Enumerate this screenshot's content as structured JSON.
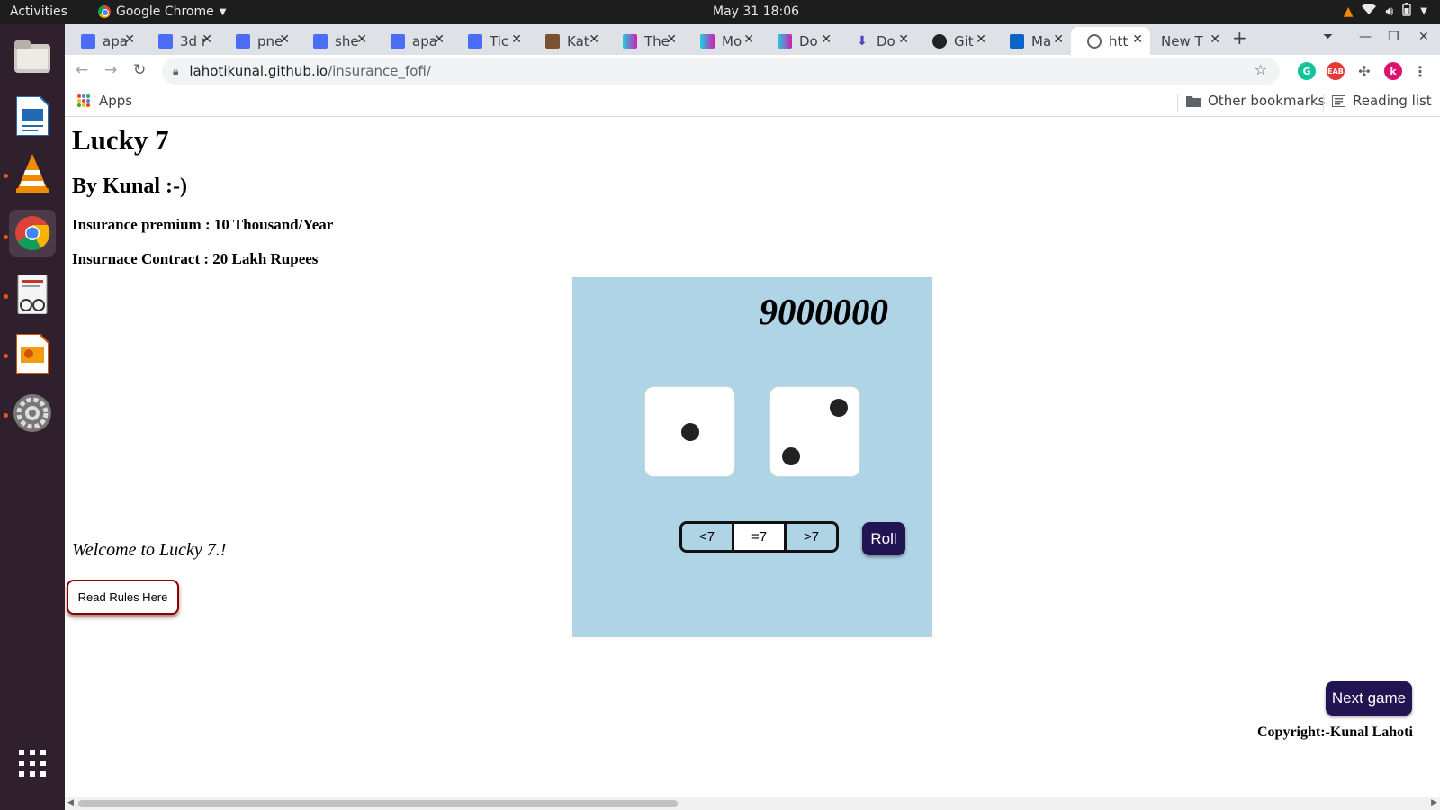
{
  "system": {
    "activities": "Activities",
    "app_name": "Google Chrome",
    "clock": "May 31  18:06"
  },
  "dock": {
    "items": [
      "files-icon",
      "writer-icon",
      "vlc-icon",
      "chrome-icon",
      "reader-icon",
      "impress-icon",
      "settings-icon"
    ],
    "show_apps": "show-apps-icon"
  },
  "browser": {
    "tabs": [
      {
        "label": "apa",
        "icon": "docs-icon"
      },
      {
        "label": "3d r",
        "icon": "docs-icon"
      },
      {
        "label": "pne",
        "icon": "docs-icon"
      },
      {
        "label": "she",
        "icon": "docs-icon"
      },
      {
        "label": "apa",
        "icon": "docs-icon"
      },
      {
        "label": "Tic",
        "icon": "docs-icon"
      },
      {
        "label": "Kat",
        "icon": "kaggle-icon"
      },
      {
        "label": "The",
        "icon": "medium-icon"
      },
      {
        "label": "Mo",
        "icon": "medium-icon"
      },
      {
        "label": "Do",
        "icon": "medium-icon"
      },
      {
        "label": "Do",
        "icon": "download-icon"
      },
      {
        "label": "Git",
        "icon": "github-icon"
      },
      {
        "label": "Ma",
        "icon": "outlook-icon"
      },
      {
        "label": "htt",
        "icon": "globe-icon"
      },
      {
        "label": "New T",
        "icon": ""
      }
    ],
    "active_tab_index": 13,
    "url_host": "lahotikunal.github.io",
    "url_path": "/insurance_fofi/",
    "bookmarks": {
      "apps": "Apps",
      "other": "Other bookmarks",
      "reading": "Reading list"
    },
    "profile_initial": "k"
  },
  "page": {
    "title": "Lucky 7",
    "subtitle": "By Kunal :-)",
    "premium": "Insurance premium : 10 Thousand/Year",
    "contract": "Insurnace Contract : 20 Lakh Rupees",
    "welcome": "Welcome to Lucky 7.!",
    "rules_button": "Read Rules Here",
    "game": {
      "score": "9000000",
      "die1": 1,
      "die2": 2,
      "choices": [
        "<7",
        "=7",
        ">7"
      ],
      "selected_choice": "=7",
      "roll_button": "Roll"
    },
    "next_game": "Next game",
    "copyright": "Copyright:-Kunal Lahoti"
  },
  "colors": {
    "game_bg": "#aed4e6",
    "button_dark": "#221452",
    "rules_border": "#8b0000",
    "dock_bg": "#30202e"
  }
}
